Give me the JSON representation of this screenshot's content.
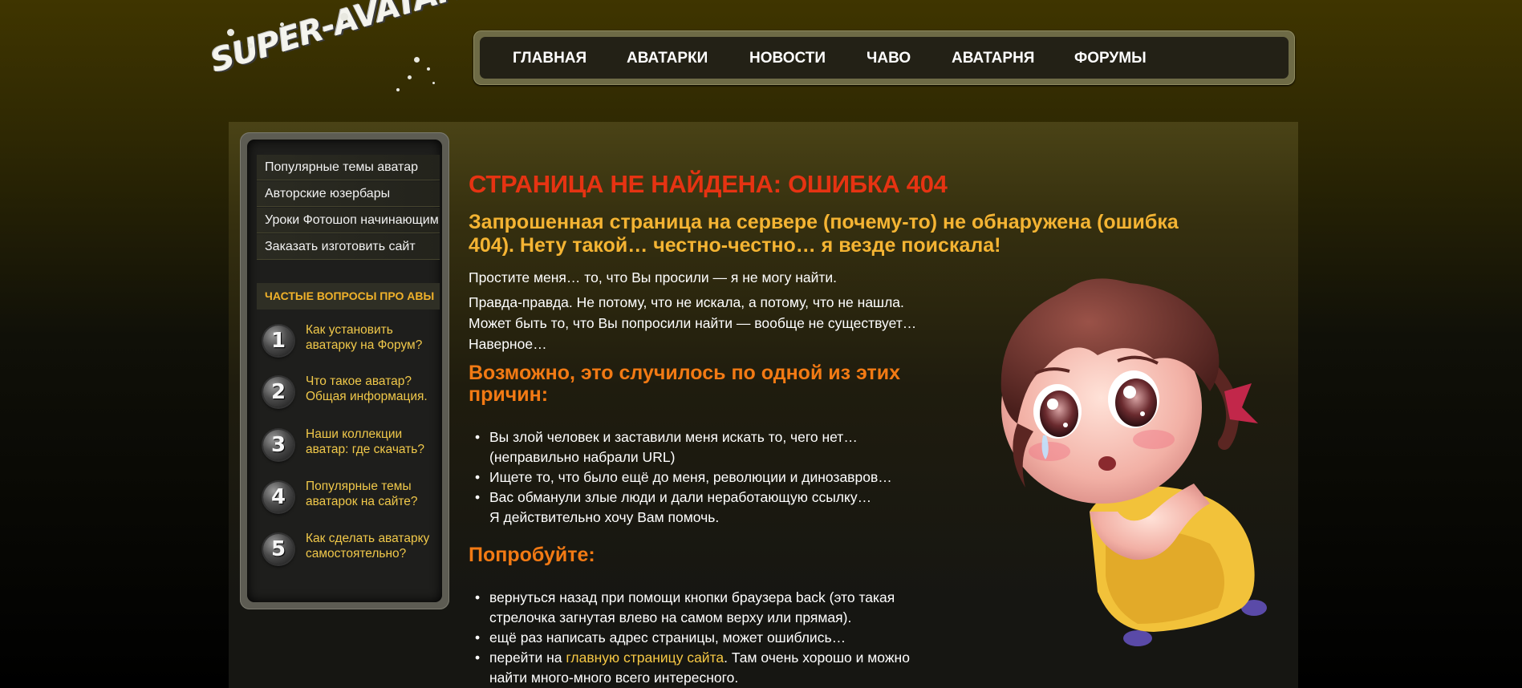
{
  "logo": {
    "text": "SUPER-AVATARA"
  },
  "topnav": {
    "items": [
      {
        "label": "ГЛАВНАЯ"
      },
      {
        "label": "АВАТАРКИ"
      },
      {
        "label": "НОВОСТИ"
      },
      {
        "label": "ЧАВО"
      },
      {
        "label": "АВАТАРНЯ"
      },
      {
        "label": "ФОРУМЫ"
      }
    ]
  },
  "sidebar": {
    "links": [
      {
        "label": "Популярные темы аватар"
      },
      {
        "label": "Авторские юзербары"
      },
      {
        "label": "Уроки Фотошоп начинающим"
      },
      {
        "label": "Заказать изготовить сайт"
      }
    ],
    "faq_heading": "ЧАСТЫЕ ВОПРОСЫ ПРО АВЫ",
    "faq": [
      {
        "num": "1",
        "line1": "Как установить",
        "line2": "аватарку на Форум?"
      },
      {
        "num": "2",
        "line1": "Что такое аватар?",
        "line2": "Общая информация."
      },
      {
        "num": "3",
        "line1": "Наши коллекции",
        "line2": "аватар: где скачать?"
      },
      {
        "num": "4",
        "line1": "Популярные темы",
        "line2": "аватарок на сайте?"
      },
      {
        "num": "5",
        "line1": "Как сделать аватарку",
        "line2": "самостоятельно?"
      }
    ]
  },
  "main": {
    "title": "СТРАНИЦА НЕ НАЙДЕНА: ОШИБКА 404",
    "subtitle_line1": "Запрошенная страница на сервере (почему-то) не обнаружена (ошибка",
    "subtitle_line2": "404). Нету такой… честно-честно… я везде поискала!",
    "para1": "Простите меня… то, что Вы просили — я не могу найти.",
    "para2_line1": "Правда-правда. Не потому, что не искала, а потому, что не нашла.",
    "para2_line2": "Может быть то, что Вы попросили найти — вообще не существует…",
    "para2_line3": "Наверное…",
    "reasons_title_line1": "Возможно, это случилось по одной из этих",
    "reasons_title_line2": "причин:",
    "reasons": [
      {
        "line1": "Вы злой человек и заставили меня искать то, чего нет…",
        "line2": "(неправильно набрали URL)"
      },
      {
        "line1": "Ищете то, что было ещё до меня, революции и динозавров…",
        "line2": ""
      },
      {
        "line1": "Вас обманули злые люди и дали неработающую ссылку…",
        "line2": "Я действительно хочу Вам помочь."
      }
    ],
    "try_title": "Попробуйте:",
    "try_items": {
      "item1_line1": "вернуться назад при помощи кнопки браузера back (это такая",
      "item1_line2": "стрелочка загнутая влево на самом верху или прямая).",
      "item2": "ещё раз написать адрес страницы, может ошиблись…",
      "item3_prefix": "перейти на ",
      "item3_link": "главную страницу сайта",
      "item3_suffix": ". Там очень хорошо и можно",
      "item3_line2": "найти много-много всего интересного."
    }
  },
  "colors": {
    "title_red": "#e63312",
    "subtitle_gold": "#f4b433",
    "heading_orange": "#f27a14",
    "link_yellow": "#f6c844"
  }
}
